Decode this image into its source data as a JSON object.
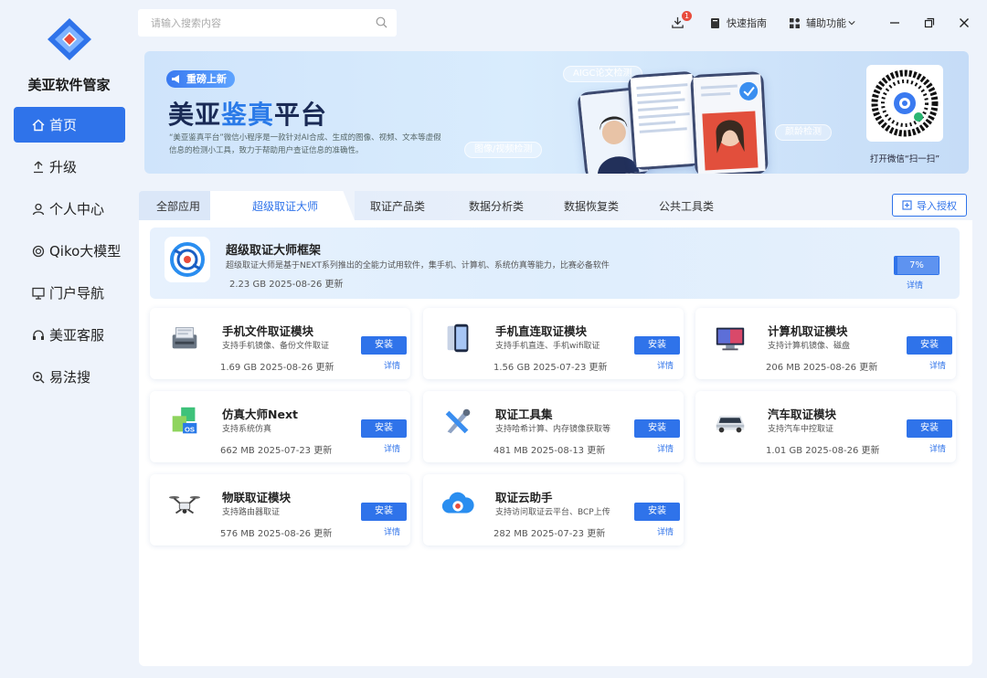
{
  "app": {
    "name": "美亚软件管家"
  },
  "sidebar": {
    "items": [
      {
        "label": "首页",
        "icon": "home-icon",
        "active": true
      },
      {
        "label": "升级",
        "icon": "upgrade-icon"
      },
      {
        "label": "个人中心",
        "icon": "user-icon"
      },
      {
        "label": "Qiko大模型",
        "icon": "ai-model-icon"
      },
      {
        "label": "门户导航",
        "icon": "monitor-icon"
      },
      {
        "label": "美亚客服",
        "icon": "headset-icon"
      },
      {
        "label": "易法搜",
        "icon": "search-law-icon"
      }
    ]
  },
  "search": {
    "placeholder": "请输入搜索内容"
  },
  "topbar": {
    "download_badge": "1",
    "quick_guide": "快速指南",
    "assist": "辅助功能"
  },
  "banner": {
    "tag": "重磅上新",
    "title_a": "美亚",
    "title_b": "鉴真",
    "title_c": "平台",
    "desc": "“美亚鉴真平台”微信小程序是一款针对AI合成、生成的图像、视频、文本等虚假信息的检测小工具，致力于帮助用户查证信息的准确性。",
    "pill_1": "AIGC论文检测",
    "pill_2": "图像/视频检测",
    "pill_3": "颜龄检测",
    "qr_caption": "打开微信“扫一扫”"
  },
  "tabs": [
    {
      "label": "全部应用"
    },
    {
      "label": "超级取证大师",
      "active": true
    },
    {
      "label": "取证产品类"
    },
    {
      "label": "数据分析类"
    },
    {
      "label": "数据恢复类"
    },
    {
      "label": "公共工具类"
    }
  ],
  "import_button": "导入授权",
  "featured": {
    "name": "超级取证大师框架",
    "desc": "超级取证大师是基于NEXT系列推出的全能力试用软件，集手机、计算机、系统仿真等能力，比赛必备软件",
    "meta": "2.23 GB  2025-08-26 更新",
    "progress": 7,
    "progress_label": "7%",
    "detail": "详情"
  },
  "apps": [
    {
      "name": "手机文件取证模块",
      "desc": "支持手机镜像、备份文件取证",
      "meta": "1.69 GB  2025-08-26 更新",
      "install": "安装",
      "detail": "详情",
      "icon": "scanner-icon"
    },
    {
      "name": "手机直连取证模块",
      "desc": "支持手机直连、手机wifi取证",
      "meta": "1.56 GB  2025-07-23 更新",
      "install": "安装",
      "detail": "详情",
      "icon": "phone-icon"
    },
    {
      "name": "计算机取证模块",
      "desc": "支持计算机镜像、磁盘",
      "meta": "206 MB  2025-08-26 更新",
      "install": "安装",
      "detail": "详情",
      "icon": "computer-icon"
    },
    {
      "name": "仿真大师Next",
      "desc": "支持系统仿真",
      "meta": "662 MB  2025-07-23 更新",
      "install": "安装",
      "detail": "详情",
      "icon": "os-icon"
    },
    {
      "name": "取证工具集",
      "desc": "支持哈希计算、内存镜像获取等",
      "meta": "481 MB  2025-08-13 更新",
      "install": "安装",
      "detail": "详情",
      "icon": "toolkit-icon"
    },
    {
      "name": "汽车取证模块",
      "desc": "支持汽车中控取证",
      "meta": "1.01 GB  2025-08-26 更新",
      "install": "安装",
      "detail": "详情",
      "icon": "car-icon"
    },
    {
      "name": "物联取证模块",
      "desc": "支持路由器取证",
      "meta": "576 MB  2025-08-26 更新",
      "install": "安装",
      "detail": "详情",
      "icon": "drone-icon"
    },
    {
      "name": "取证云助手",
      "desc": "支持访问取证云平台、BCP上传",
      "meta": "282 MB  2025-07-23 更新",
      "install": "安装",
      "detail": "详情",
      "icon": "cloud-icon"
    }
  ]
}
